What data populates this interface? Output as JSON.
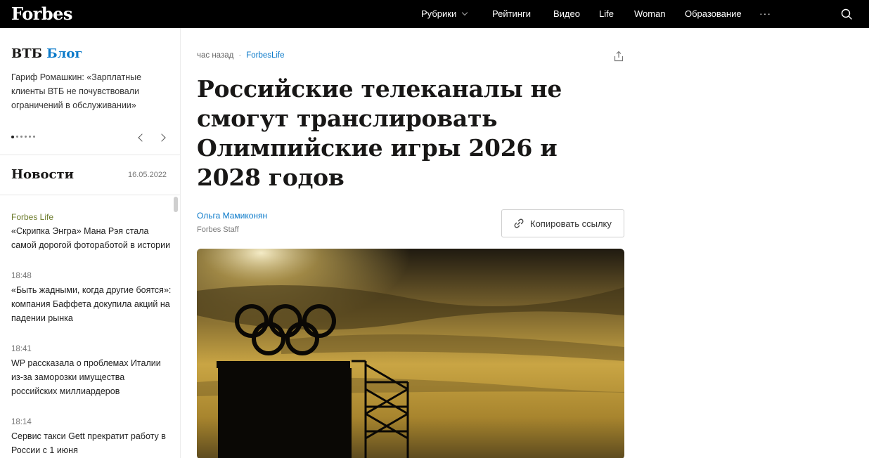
{
  "header": {
    "logo": "Forbes",
    "nav": [
      {
        "label": "Рубрики"
      },
      {
        "label": "Рейтинги"
      },
      {
        "label": "Видео"
      },
      {
        "label": "Life"
      },
      {
        "label": "Woman"
      },
      {
        "label": "Образование"
      }
    ],
    "more_icon": "more-dots-icon",
    "search_icon": "search-icon"
  },
  "sidebar": {
    "vtb": {
      "brand": "ВТБ",
      "brand_accent": "Блог",
      "text": "Гариф Ромашкин: «Зарплатные клиенты ВТБ не почувствовали ограничений в обслуживании»",
      "pager_count": 6,
      "pager_active": 1
    },
    "news_heading": "Новости",
    "news_date": "16.05.2022",
    "news": [
      {
        "time": "Forbes Life",
        "title": "«Скрипка Энгра» Мана Рэя стала самой дорогой фотоработой в истории"
      },
      {
        "time": "18:48",
        "title": "«Быть жадными, когда другие боятся»: компания Баффета докупила акций на падении рынка"
      },
      {
        "time": "18:41",
        "title": "WP рассказала о проблемах Италии из-за заморозки имущества российских миллиардеров"
      },
      {
        "time": "18:14",
        "title": "Сервис такси Gett прекратит работу в России с 1 июня"
      }
    ]
  },
  "article": {
    "published": "час назад",
    "separator": "·",
    "rubric": "ForbesLife",
    "title": "Российские телеканалы не смогут транслировать Олимпийские игры 2026 и 2028 годов",
    "author": "Ольга Мамиконян",
    "author_role": "Forbes Staff",
    "copy_link_label": "Копировать ссылку"
  },
  "colors": {
    "accent_blue": "#0a79c9",
    "header_bg": "#000000",
    "rubric_green": "#6b7a2a"
  }
}
